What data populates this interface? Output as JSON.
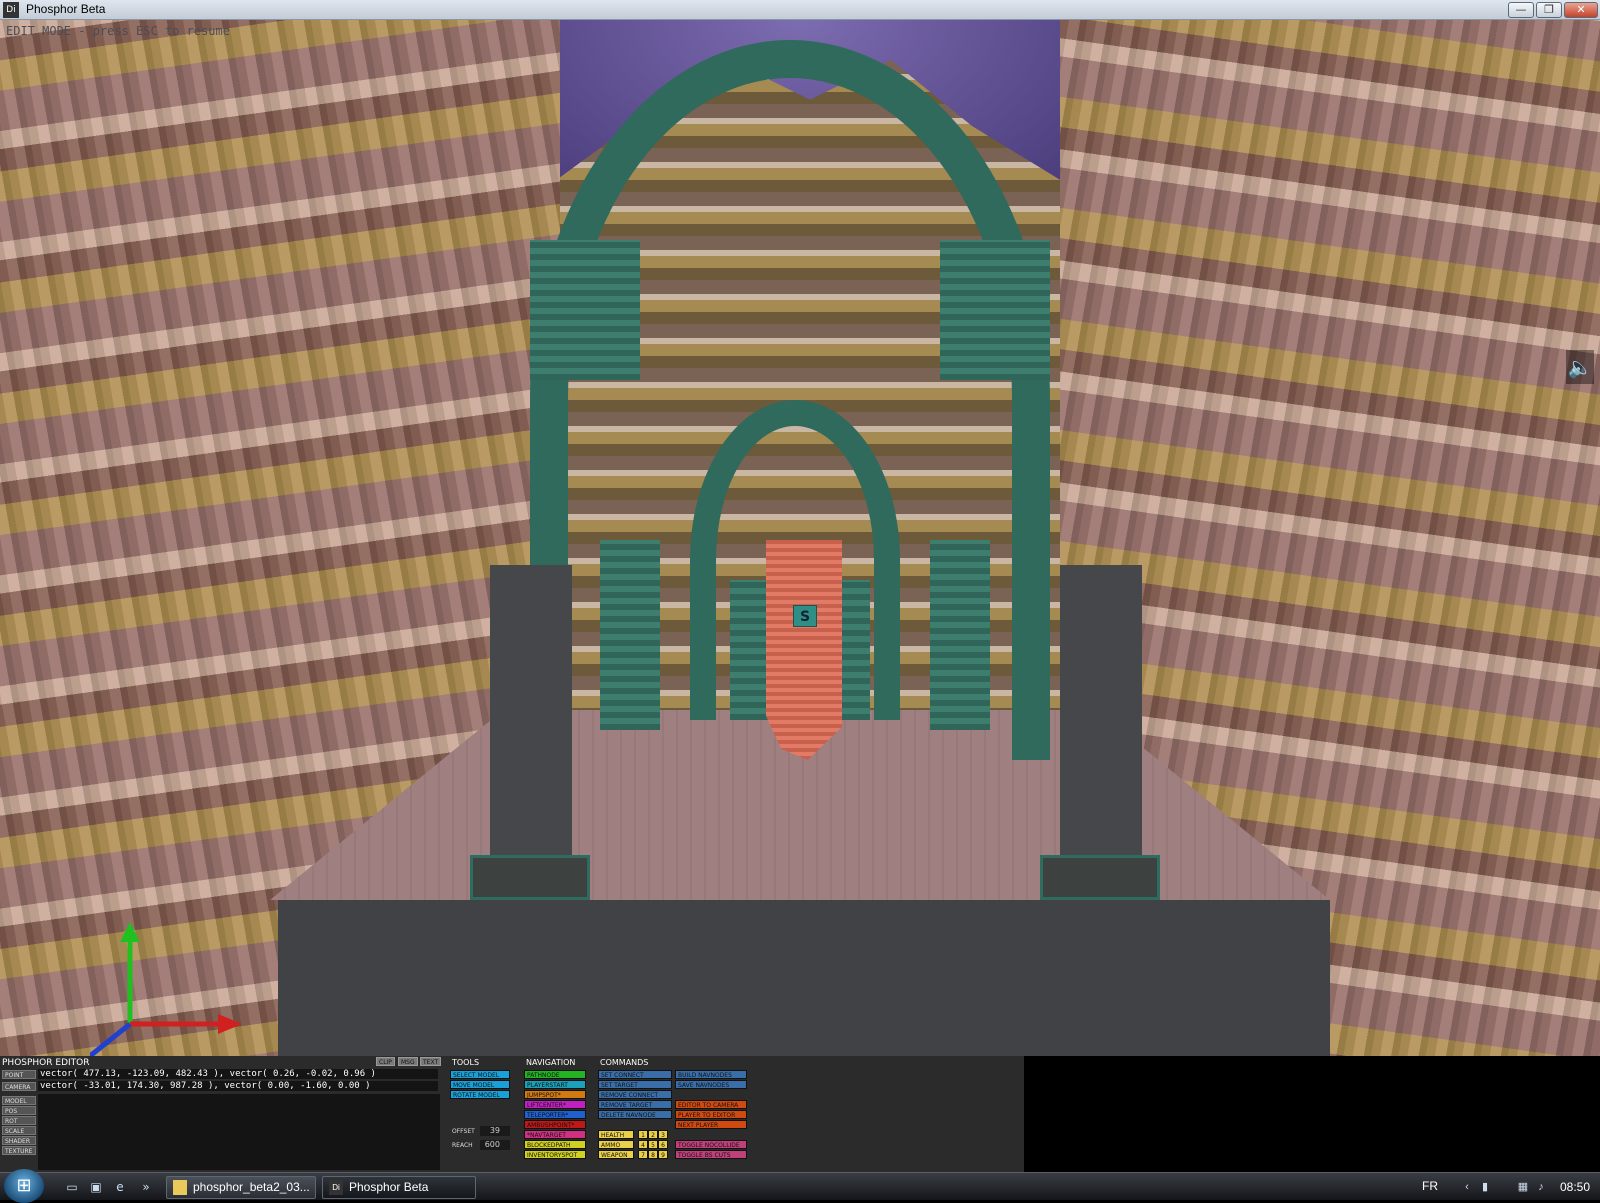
{
  "window": {
    "title": "Phosphor Beta",
    "app_icon": "Di",
    "buttons": {
      "minimize": "—",
      "maximize": "❐",
      "close": "✕"
    }
  },
  "viewport": {
    "edit_message": "EDIT MODE - press ESC to resume",
    "marker_label": "S"
  },
  "editor": {
    "title": "PHOSPHOR EDITOR",
    "flags": [
      "CLIP",
      "MSG",
      "TEXT"
    ],
    "labels": {
      "point": "POINT",
      "camera": "CAMERA",
      "model": "MODEL",
      "pos": "POS",
      "rot": "ROT",
      "scale": "SCALE",
      "shader": "SHADER",
      "texture": "TEXTURE"
    },
    "point_value": "vector( 477.13, -123.09, 482.43 ), vector( 0.26, -0.02, 0.96 )",
    "camera_value": "vector( -33.01, 174.30, 987.28 ), vector( 0.00, -1.60, 0.00 )",
    "tools": {
      "header": "TOOLS",
      "items": [
        "SELECT MODEL",
        "MOVE MODEL",
        "ROTATE MODEL"
      ],
      "offset_label": "OFFSET",
      "offset_value": "39",
      "reach_label": "REACH",
      "reach_value": "600"
    },
    "navigation": {
      "header": "NAVIGATION",
      "items": [
        "PATHNODE",
        "PLAYERSTART",
        "JUMPSPOT*",
        "LIFTCENTER*",
        "TELEPORTER*",
        "AMBUSHPOINT*",
        "*NAVTARGET",
        "BLOCKEDPATH",
        "INVENTORYSPOT"
      ]
    },
    "inventory": {
      "items": [
        "HEALTH",
        "AMMO",
        "WEAPON"
      ],
      "numbers": [
        [
          "1",
          "2",
          "3"
        ],
        [
          "4",
          "5",
          "6"
        ],
        [
          "7",
          "8",
          "9"
        ]
      ]
    },
    "commands": {
      "header": "COMMANDS",
      "col1": [
        "SET CONNECT",
        "SET TARGET",
        "REMOVE CONNECT",
        "REMOVE TARGET",
        "DELETE NAVNODE"
      ],
      "col2": [
        "BUILD NAVNODES",
        "SAVE NAVNODES",
        "EDITOR TO CAMERA",
        "PLAYER TO EDITOR",
        "NEXT PLAYER",
        "TOGGLE NOCOLLIDE",
        "TOGGLE BS CUTS"
      ]
    }
  },
  "taskbar": {
    "tasks": [
      "phosphor_beta2_03...",
      "Phosphor Beta"
    ],
    "language": "FR",
    "clock": "08:50",
    "overflow": "»"
  },
  "colors": {
    "tool_btn": "#1aa0d8",
    "nav_green": "#22b422",
    "nav_orange": "#d07a10",
    "nav_magenta": "#c020c0",
    "nav_blue": "#2060d0",
    "nav_red": "#c01818",
    "nav_pink": "#d03080",
    "nav_yellow": "#d0d020",
    "cmd_blue": "#3a6ea8",
    "cmd_orange": "#d04a10",
    "cmd_pink": "#c0407a"
  }
}
